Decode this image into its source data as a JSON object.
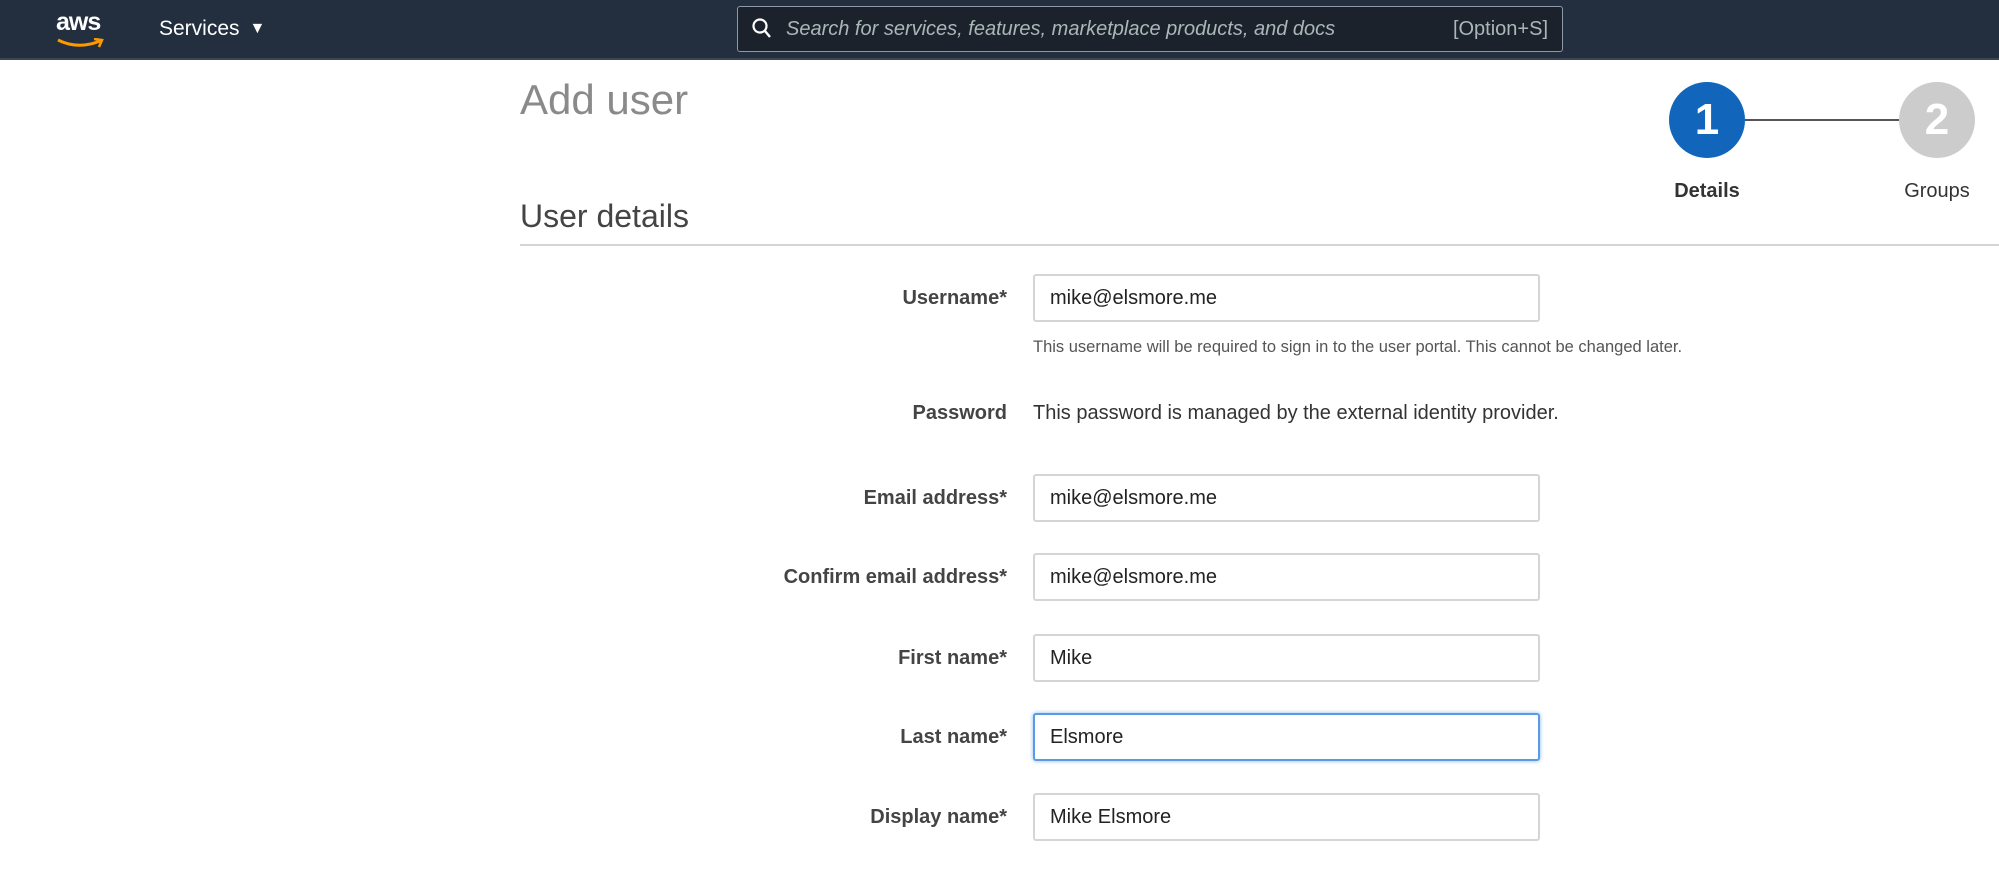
{
  "nav": {
    "logo": "aws",
    "services": "Services",
    "search_placeholder": "Search for services, features, marketplace products, and docs",
    "search_shortcut": "[Option+S]"
  },
  "page": {
    "title": "Add user",
    "section": "User details"
  },
  "steps": [
    {
      "number": "1",
      "label": "Details",
      "active": true
    },
    {
      "number": "2",
      "label": "Groups",
      "active": false
    }
  ],
  "colors": {
    "nav": "#232f3e",
    "active_step": "#1166bb",
    "inactive_step": "#cccccc",
    "focus": "#5b9be6"
  },
  "form": {
    "username": {
      "label": "Username*",
      "value": "mike@elsmore.me",
      "help": "This username will be required to sign in to the user portal. This cannot be changed later."
    },
    "password": {
      "label": "Password",
      "text": "This password is managed by the external identity provider."
    },
    "email": {
      "label": "Email address*",
      "value": "mike@elsmore.me"
    },
    "confirm_email": {
      "label": "Confirm email address*",
      "value": "mike@elsmore.me"
    },
    "first_name": {
      "label": "First name*",
      "value": "Mike"
    },
    "last_name": {
      "label": "Last name*",
      "value": "Elsmore"
    },
    "display_name": {
      "label": "Display name*",
      "value": "Mike Elsmore"
    }
  }
}
